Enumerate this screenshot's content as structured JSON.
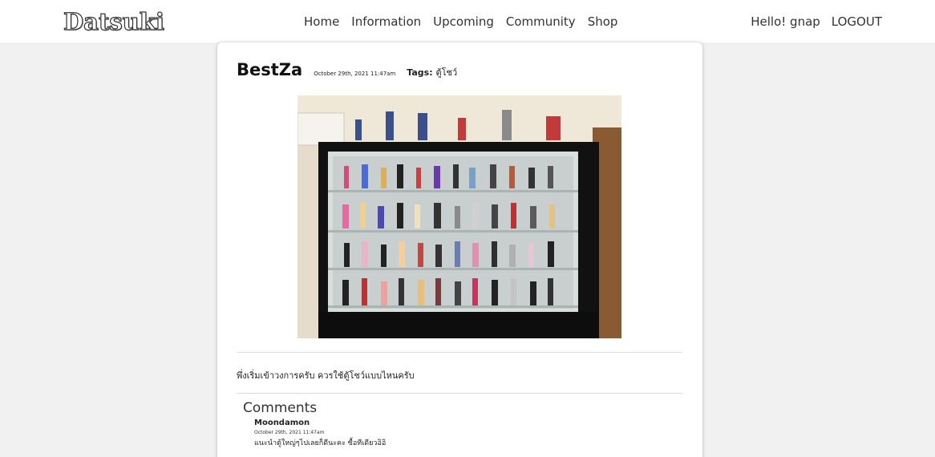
{
  "site": {
    "logo": "Datsuki"
  },
  "nav": {
    "items": [
      "Home",
      "Information",
      "Upcoming",
      "Community",
      "Shop"
    ]
  },
  "user": {
    "greeting": "Hello! gnap",
    "logout": "LOGOUT"
  },
  "post": {
    "author": "BestZa",
    "date": "October 29th, 2021 11:47am",
    "tags_label": "Tags:",
    "tags_value": "ตู้โชว์",
    "body": "พึ่งเริ่มเข้าวงการครับ ควรใช้ตู้โชว์แบบไหนครับ"
  },
  "comments": {
    "title": "Comments",
    "items": [
      {
        "author": "Moondamon",
        "date": "October 29th, 2021 11:47am",
        "text": "แนะนำตู้ใหญ่ๆไปเลยก็ดีนะคะ ซื้อทีเดียวอิอิ"
      }
    ]
  }
}
